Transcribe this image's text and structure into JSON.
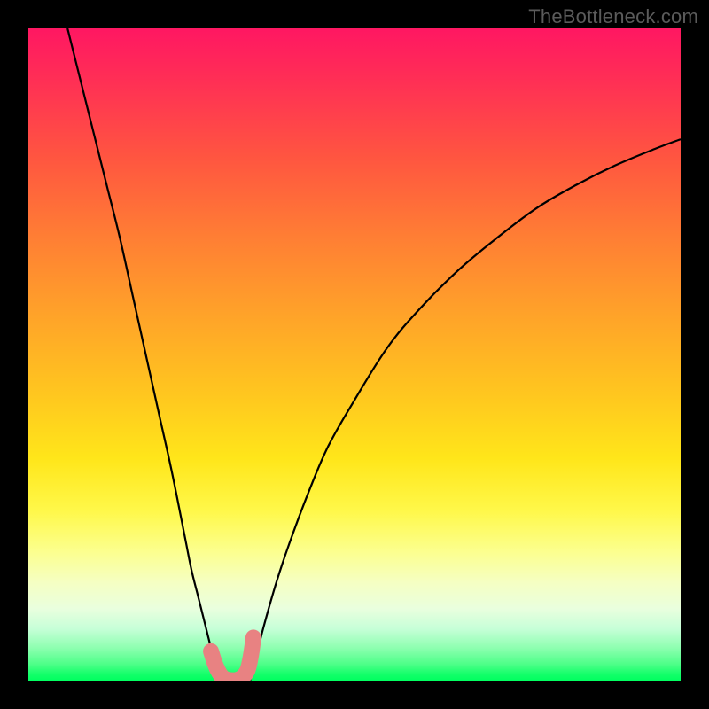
{
  "watermark": "TheBottleneck.com",
  "chart_data": {
    "type": "line",
    "title": "",
    "xlabel": "",
    "ylabel": "",
    "xlim": [
      0,
      100
    ],
    "ylim": [
      0,
      100
    ],
    "grid": false,
    "legend": false,
    "series": [
      {
        "name": "left-branch",
        "color": "#000000",
        "x": [
          6,
          8,
          10,
          12,
          14,
          16,
          18,
          20,
          22,
          24,
          25,
          26,
          27,
          28,
          28.5,
          29,
          29.3
        ],
        "y": [
          100,
          92,
          84,
          76,
          68,
          59,
          50,
          41,
          32,
          22,
          17,
          13,
          9,
          5,
          3,
          1.2,
          0
        ]
      },
      {
        "name": "right-branch",
        "color": "#000000",
        "x": [
          34,
          34.3,
          35,
          36,
          38,
          40,
          43,
          46,
          50,
          55,
          60,
          66,
          72,
          78,
          84,
          90,
          96,
          100
        ],
        "y": [
          0,
          1.5,
          4,
          8,
          15,
          21,
          29,
          36,
          43,
          51,
          57,
          63,
          68,
          72.5,
          76,
          79,
          81.5,
          83
        ]
      },
      {
        "name": "bottom-marker",
        "color": "#e88282",
        "stroke_width_px": 18,
        "linecap": "round",
        "x": [
          28.0,
          28.6,
          29.2,
          29.8,
          30.5,
          31.3,
          32.1,
          32.9,
          33.6,
          34.0,
          34.3,
          34.5
        ],
        "y": [
          4.5,
          2.6,
          1.3,
          0.5,
          0.15,
          0.05,
          0.15,
          0.6,
          1.6,
          3.2,
          5.0,
          6.6
        ]
      }
    ],
    "gradient_stops": [
      {
        "pos": 0.0,
        "color": "#ff1762"
      },
      {
        "pos": 0.08,
        "color": "#ff2f55"
      },
      {
        "pos": 0.2,
        "color": "#ff5640"
      },
      {
        "pos": 0.32,
        "color": "#ff7e34"
      },
      {
        "pos": 0.44,
        "color": "#ffa329"
      },
      {
        "pos": 0.56,
        "color": "#ffc61f"
      },
      {
        "pos": 0.66,
        "color": "#ffe61a"
      },
      {
        "pos": 0.74,
        "color": "#fff84a"
      },
      {
        "pos": 0.8,
        "color": "#fcff8c"
      },
      {
        "pos": 0.85,
        "color": "#f5ffc3"
      },
      {
        "pos": 0.89,
        "color": "#e9ffde"
      },
      {
        "pos": 0.92,
        "color": "#c7ffd8"
      },
      {
        "pos": 0.95,
        "color": "#8dffb0"
      },
      {
        "pos": 0.975,
        "color": "#4dff88"
      },
      {
        "pos": 0.99,
        "color": "#14ff6a"
      },
      {
        "pos": 1.0,
        "color": "#00ff60"
      }
    ]
  }
}
